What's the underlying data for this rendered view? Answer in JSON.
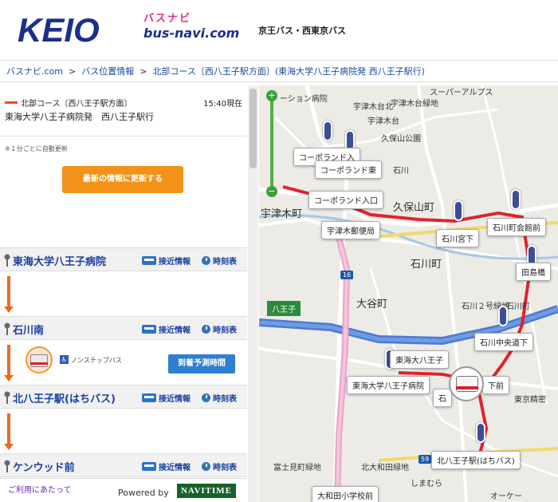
{
  "header": {
    "keio_logo": "KEIO",
    "busnavi_kana": "バスナビ",
    "busnavi_text": "bus-navi.com",
    "company": "京王バス・西東京バス"
  },
  "breadcrumb": {
    "items": [
      "バスナビ.com",
      "バス位置情報",
      "北部コース〔西八王子駅方面〕(東海大学八王子病院発 西八王子駅行)"
    ],
    "separator": ">"
  },
  "route": {
    "name": "北部コース〔西八王子駅方面〕",
    "time": "15:40現在",
    "description": "東海大学八王子病院発　西八王子駅行",
    "color": "#e8500f"
  },
  "auto_update": "※１分ごとに自動更新",
  "refresh_button": "最新の情報に更新する",
  "stops": [
    {
      "name": "東海大学八王子病院",
      "approach": "接近情報",
      "timetable": "時刻表"
    },
    {
      "name": "石川南",
      "approach": "接近情報",
      "timetable": "時刻表"
    },
    {
      "name": "北八王子駅(はちバス)",
      "approach": "接近情報",
      "timetable": "時刻表"
    },
    {
      "name": "ケンウッド前",
      "approach": "接近情報",
      "timetable": "時刻表"
    }
  ],
  "bus_info": {
    "nonstep": "ノンステップバス",
    "arrival_button": "到着予測時間"
  },
  "footer": {
    "terms": "ご利用にあたって",
    "powered_by": "Powered by",
    "navitime": "NAVITIME"
  },
  "map": {
    "place_labels": [
      {
        "text": "ーション病院"
      },
      {
        "text": "宇津木台北"
      },
      {
        "text": "宇津木台緑地"
      },
      {
        "text": "スーパーアルプス"
      },
      {
        "text": "宇津木台"
      },
      {
        "text": "久保山公園"
      },
      {
        "text": "石川"
      },
      {
        "text": "宇津木町"
      },
      {
        "text": "久保山町"
      },
      {
        "text": "石川町"
      },
      {
        "text": "大谷町"
      },
      {
        "text": "石川２号緑地"
      },
      {
        "text": "石川町"
      },
      {
        "text": "東京精密"
      },
      {
        "text": "富士見町緑地"
      },
      {
        "text": "北大和田緑地"
      },
      {
        "text": "しまむら"
      },
      {
        "text": "オーケー"
      },
      {
        "text": "八王子"
      },
      {
        "text": "16"
      },
      {
        "text": "59"
      }
    ],
    "stop_labels": [
      {
        "text": "コーポランド入"
      },
      {
        "text": "コーポランド東"
      },
      {
        "text": "コーポランド入口"
      },
      {
        "text": "宇津木郵便局"
      },
      {
        "text": "石川宮下"
      },
      {
        "text": "石川町会館前"
      },
      {
        "text": "田島橋"
      },
      {
        "text": "石川中央道下"
      },
      {
        "text": "東海大学八王子病院"
      },
      {
        "text": "北八王子駅(はちバス)"
      },
      {
        "text": "東海大八王子"
      },
      {
        "text": "石"
      },
      {
        "text": "下前"
      },
      {
        "text": "大和田小学校前"
      }
    ],
    "zoom_plus": "+",
    "zoom_minus": "−"
  }
}
